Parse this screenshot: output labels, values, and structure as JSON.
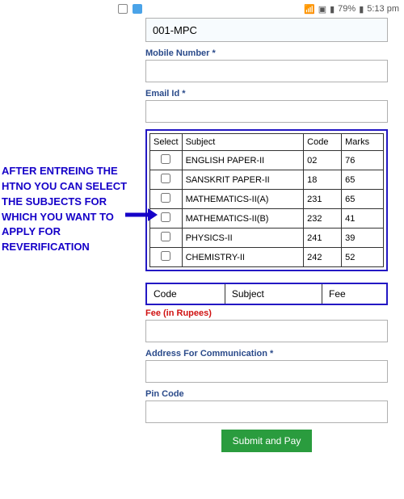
{
  "statusbar": {
    "signal": "79%",
    "time": "5:13 pm"
  },
  "annotation": {
    "text": "AFTER ENTREING THE HTNO YOU CAN SELECT THE SUBJECTS FOR WHICH YOU WANT TO APPLY FOR REVERIFICATION"
  },
  "form": {
    "first_value": "001-MPC",
    "mobile_label": "Mobile Number *",
    "email_label": "Email Id *",
    "fee_label": "Fee (in Rupees)",
    "address_label": "Address For Communication *",
    "pin_label": "Pin Code",
    "submit_label": "Submit and Pay"
  },
  "subject_table": {
    "headers": {
      "select": "Select",
      "subject": "Subject",
      "code": "Code",
      "marks": "Marks"
    },
    "rows": [
      {
        "subject": "ENGLISH PAPER-II",
        "code": "02",
        "marks": "76"
      },
      {
        "subject": "SANSKRIT PAPER-II",
        "code": "18",
        "marks": "65"
      },
      {
        "subject": "MATHEMATICS-II(A)",
        "code": "231",
        "marks": "65"
      },
      {
        "subject": "MATHEMATICS-II(B)",
        "code": "232",
        "marks": "41"
      },
      {
        "subject": "PHYSICS-II",
        "code": "241",
        "marks": "39"
      },
      {
        "subject": "CHEMISTRY-II",
        "code": "242",
        "marks": "52"
      }
    ]
  },
  "fee_table": {
    "headers": {
      "code": "Code",
      "subject": "Subject",
      "fee": "Fee"
    }
  }
}
